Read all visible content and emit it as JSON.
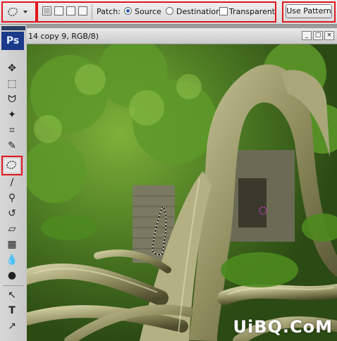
{
  "options_bar": {
    "patch_label": "Patch:",
    "source_label": "Source",
    "destination_label": "Destination",
    "transparent_label": "Transparent",
    "use_pattern_label": "Use Pattern",
    "selected_patch_mode": "Source",
    "transparent_checked": false,
    "highlight_color": "#e3141c"
  },
  "tools_palette": {
    "logo": "Ps",
    "active_tool": "patch-tool",
    "icons": {
      "move": "✥",
      "marquee": "⬚",
      "lasso": "ᗢ",
      "magic_wand": "✦",
      "crop": "⌗",
      "eyedropper": "✎",
      "patch": "◌",
      "brush": "∕",
      "stamp": "⚲",
      "history_brush": "↺",
      "eraser": "▱",
      "gradient": "▦",
      "blur": "💧",
      "dodge": "●",
      "path_select": "↖",
      "type": "T",
      "direct_select": "↗",
      "shape": "◯"
    }
  },
  "document": {
    "title": "14 copy 9, RGB/8)"
  },
  "watermark": "UiBQ.CoM"
}
